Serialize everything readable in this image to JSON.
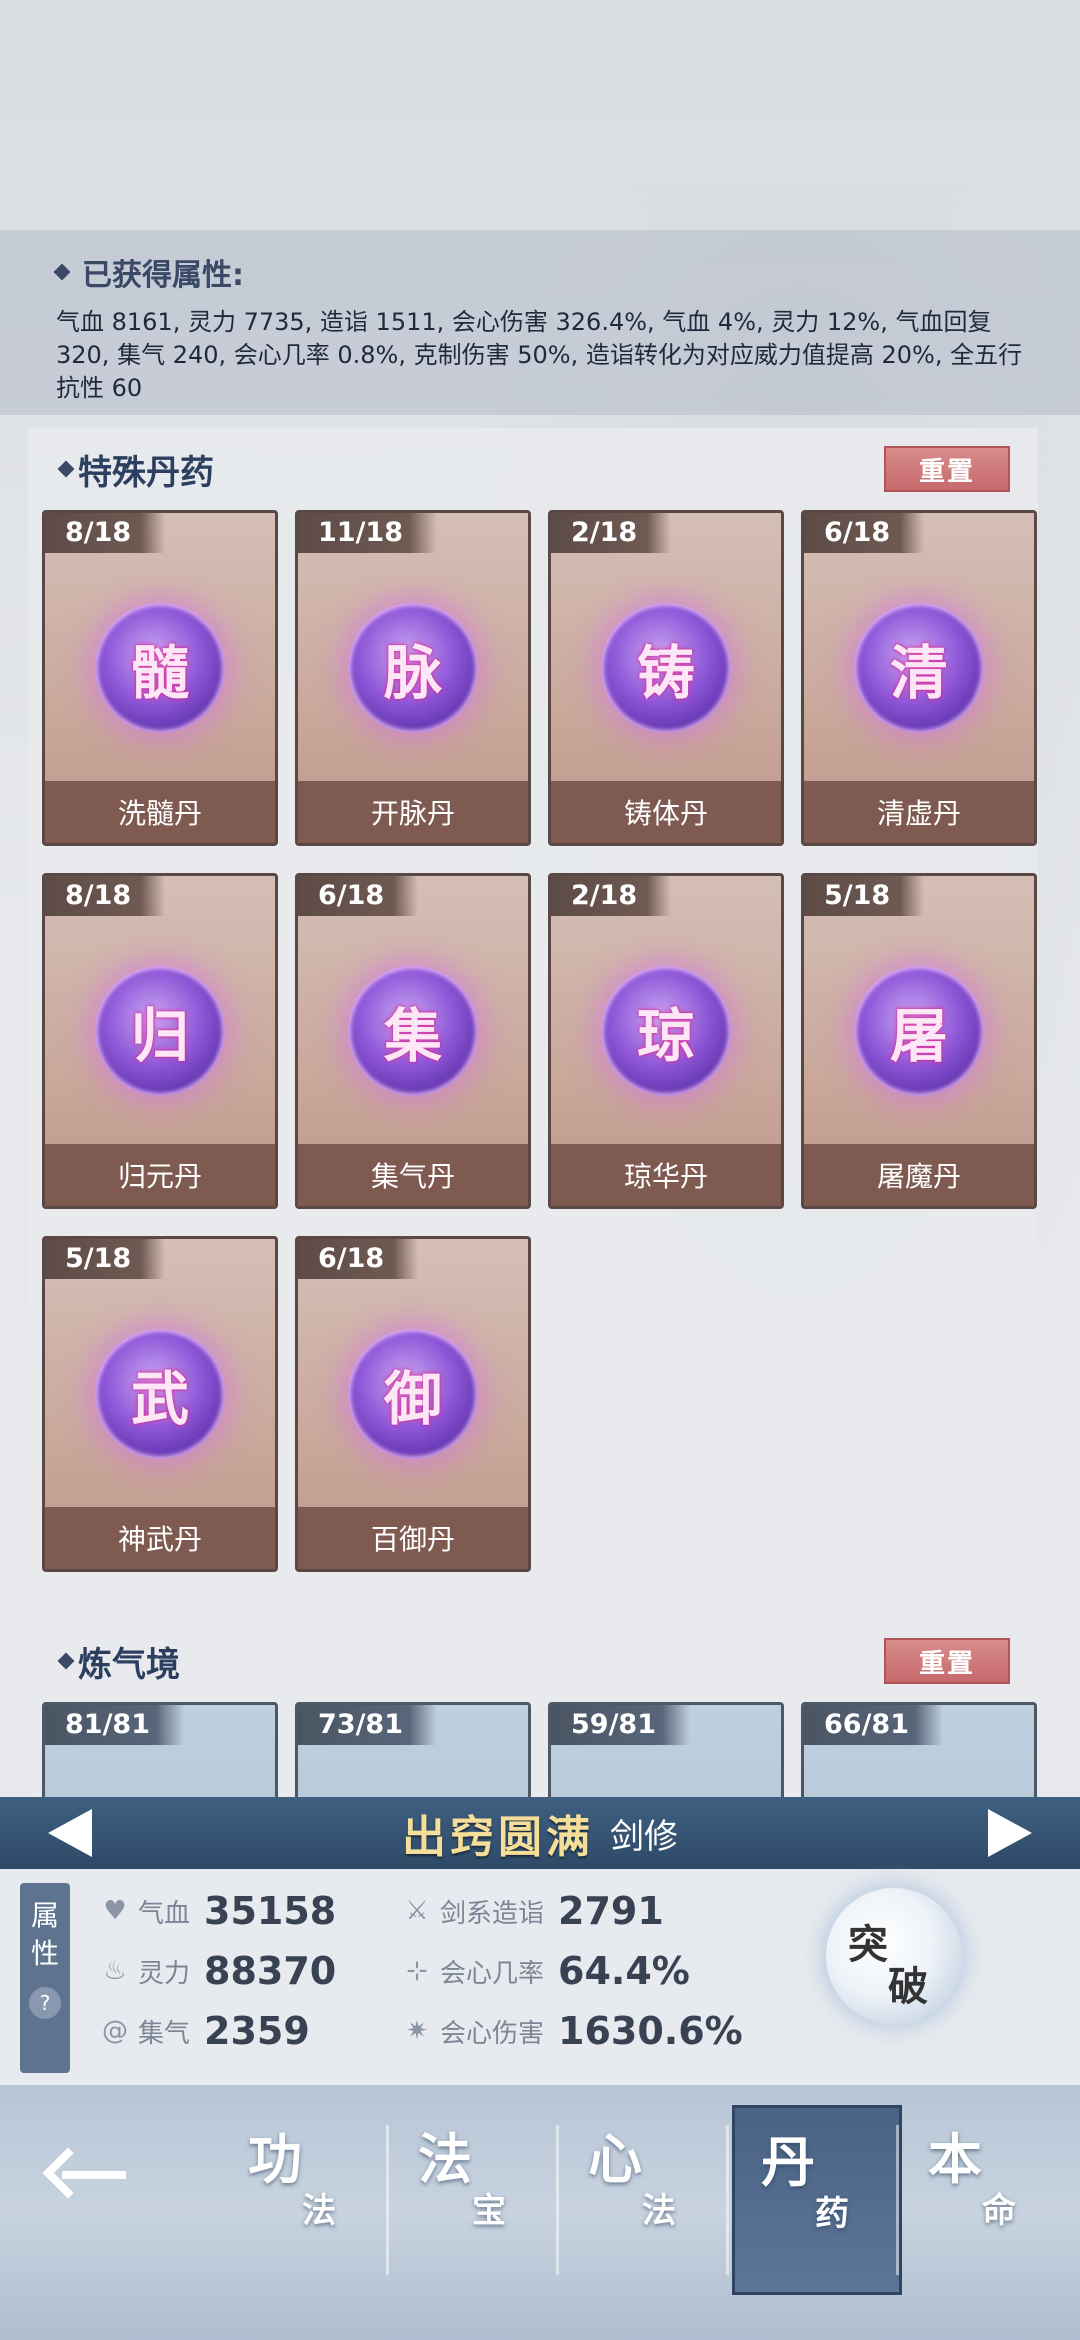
{
  "acquired": {
    "title": "已获得属性:",
    "text": "气血 8161, 灵力 7735, 造诣 1511, 会心伤害 326.4%, 气血 4%, 灵力 12%, 气血回复 320, 集气 240, 会心几率 0.8%, 克制伤害 50%, 造诣转化为对应威力值提高 20%, 全五行抗性 60"
  },
  "special_section": {
    "title": "特殊丹药",
    "reset_label": "重置",
    "items": [
      {
        "count": "8/18",
        "glyph": "髓",
        "name": "洗髓丹"
      },
      {
        "count": "11/18",
        "glyph": "脉",
        "name": "开脉丹"
      },
      {
        "count": "2/18",
        "glyph": "铸",
        "name": "铸体丹"
      },
      {
        "count": "6/18",
        "glyph": "清",
        "name": "清虚丹"
      },
      {
        "count": "8/18",
        "glyph": "归",
        "name": "归元丹"
      },
      {
        "count": "6/18",
        "glyph": "集",
        "name": "集气丹"
      },
      {
        "count": "2/18",
        "glyph": "琼",
        "name": "琼华丹"
      },
      {
        "count": "5/18",
        "glyph": "屠",
        "name": "屠魔丹"
      },
      {
        "count": "5/18",
        "glyph": "武",
        "name": "神武丹"
      },
      {
        "count": "6/18",
        "glyph": "御",
        "name": "百御丹"
      }
    ]
  },
  "realm_section": {
    "title": "炼气境",
    "reset_label": "重置",
    "items": [
      {
        "count": "81/81"
      },
      {
        "count": "73/81"
      },
      {
        "count": "59/81"
      },
      {
        "count": "66/81"
      }
    ]
  },
  "realm_bar": {
    "name": "出窍圆满",
    "class": "剑修"
  },
  "stats": {
    "tab": [
      "属",
      "性"
    ],
    "help": "?",
    "hp": {
      "icon": "heart-icon",
      "label": "气血",
      "value": "35158"
    },
    "mp": {
      "icon": "flame-icon",
      "label": "灵力",
      "value": "88370"
    },
    "charge": {
      "icon": "swirl-icon",
      "label": "集气",
      "value": "2359"
    },
    "mastery": {
      "icon": "sword-icon",
      "label": "剑系造诣",
      "value": "2791"
    },
    "crit_rate": {
      "icon": "crit-rate-icon",
      "label": "会心几率",
      "value": "64.4%"
    },
    "crit_dmg": {
      "icon": "crit-burst-icon",
      "label": "会心伤害",
      "value": "1630.6%"
    },
    "breakthrough": [
      "突",
      "破"
    ]
  },
  "nav": [
    {
      "big": "功",
      "small": "法",
      "active": false
    },
    {
      "big": "法",
      "small": "宝",
      "active": false
    },
    {
      "big": "心",
      "small": "法",
      "active": false
    },
    {
      "big": "丹",
      "small": "药",
      "active": true
    },
    {
      "big": "本",
      "small": "命",
      "active": false
    }
  ]
}
